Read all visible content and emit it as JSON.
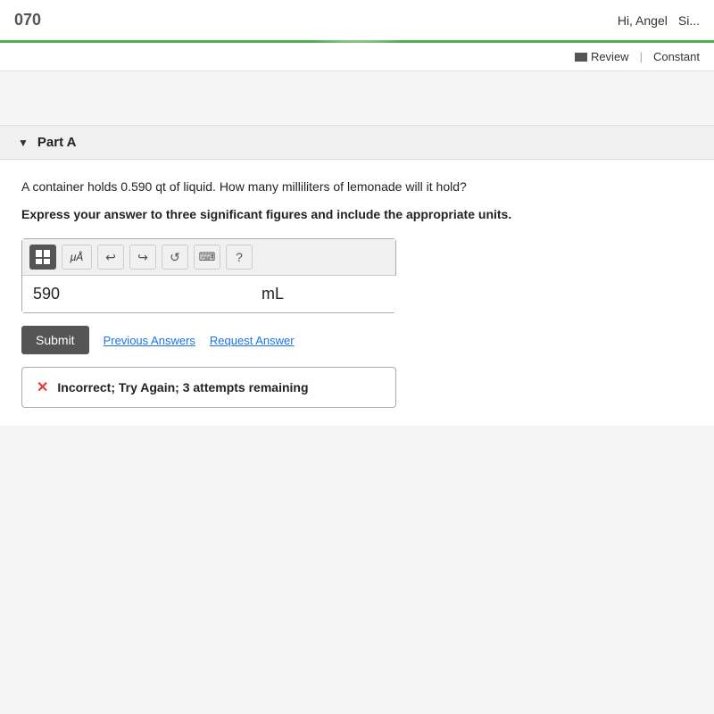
{
  "top": {
    "score": "070",
    "greeting": "Hi, Angel",
    "sign_out": "Si..."
  },
  "sub_header": {
    "review_label": "Review",
    "separator": "|",
    "constants_label": "Constant"
  },
  "part": {
    "toggle_symbol": "▼",
    "title": "Part A"
  },
  "question": {
    "text": "A container holds 0.590 qt of liquid. How many milliliters of lemonade will it hold?",
    "instruction": "Express your answer to three significant figures and include the appropriate units."
  },
  "toolbar": {
    "grid_label": "grid",
    "mu_label": "μÅ",
    "undo_label": "↩",
    "redo_label": "↪",
    "refresh_label": "↺",
    "keyboard_label": "⌨",
    "help_label": "?"
  },
  "answer": {
    "value": "590",
    "unit": "mL",
    "value_placeholder": "",
    "unit_placeholder": ""
  },
  "buttons": {
    "submit_label": "Submit",
    "previous_answers_label": "Previous Answers",
    "request_answer_label": "Request Answer"
  },
  "feedback": {
    "icon": "✕",
    "message": "Incorrect; Try Again; 3 attempts remaining"
  }
}
